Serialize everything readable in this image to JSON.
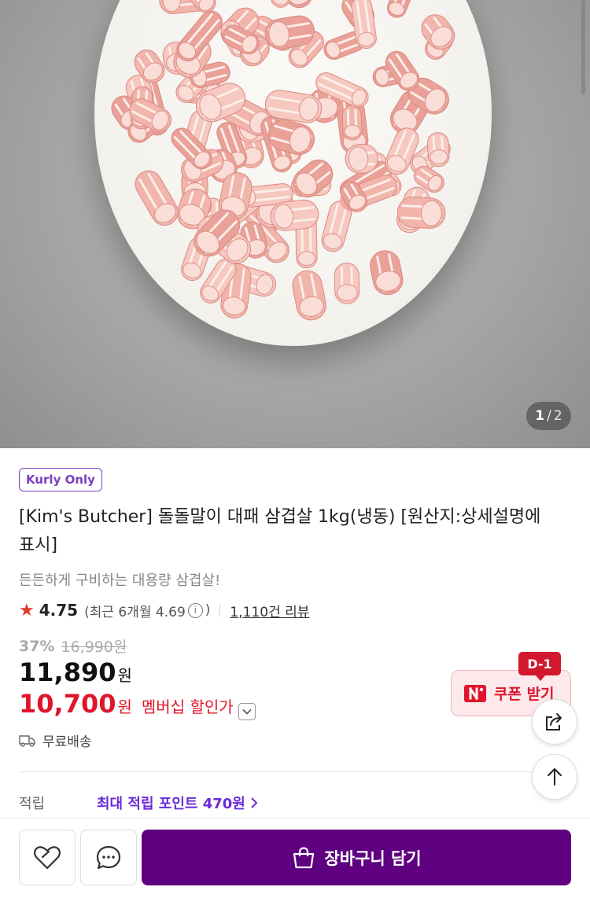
{
  "gallery": {
    "current": "1",
    "separator": "/",
    "total": "2"
  },
  "product": {
    "badge": "Kurly Only",
    "title": "[Kim's Butcher] 돌돌말이 대패 삼겹살 1kg(냉동) [원산지:상세설명에 표시]",
    "subtitle": "든든하게 구비하는 대용량 삼겹살!",
    "rating": "4.75",
    "recent_open": "(최근 6개월 4.69",
    "recent_close": ")",
    "info_glyph": "i",
    "reviews": "1,110건 리뷰",
    "discount_rate": "37%",
    "original_price": "16,990원",
    "price": "11,890",
    "price_unit": "원",
    "member_price": "10,700",
    "member_price_unit": "원",
    "member_label": "멤버십 할인가",
    "shipping": "무료배송",
    "points_label": "적립",
    "points_value": "최대 적립 포인트 470원"
  },
  "coupon": {
    "dday": "D-1",
    "label": "쿠폰 받기",
    "logo_letter": "N"
  },
  "bottom_bar": {
    "cart_label": "장바구니 담기"
  },
  "colors": {
    "kurly_purple": "#5f0080",
    "member_red": "#e0142b",
    "coupon_bg": "#fde9eb",
    "badge_purple": "#7a3ec0"
  },
  "icons": [
    "star-icon",
    "info-icon",
    "chevron-down-icon",
    "truck-icon",
    "chevron-right-icon",
    "share-icon",
    "arrow-up-icon",
    "heart-icon",
    "chat-icon",
    "cart-icon"
  ]
}
